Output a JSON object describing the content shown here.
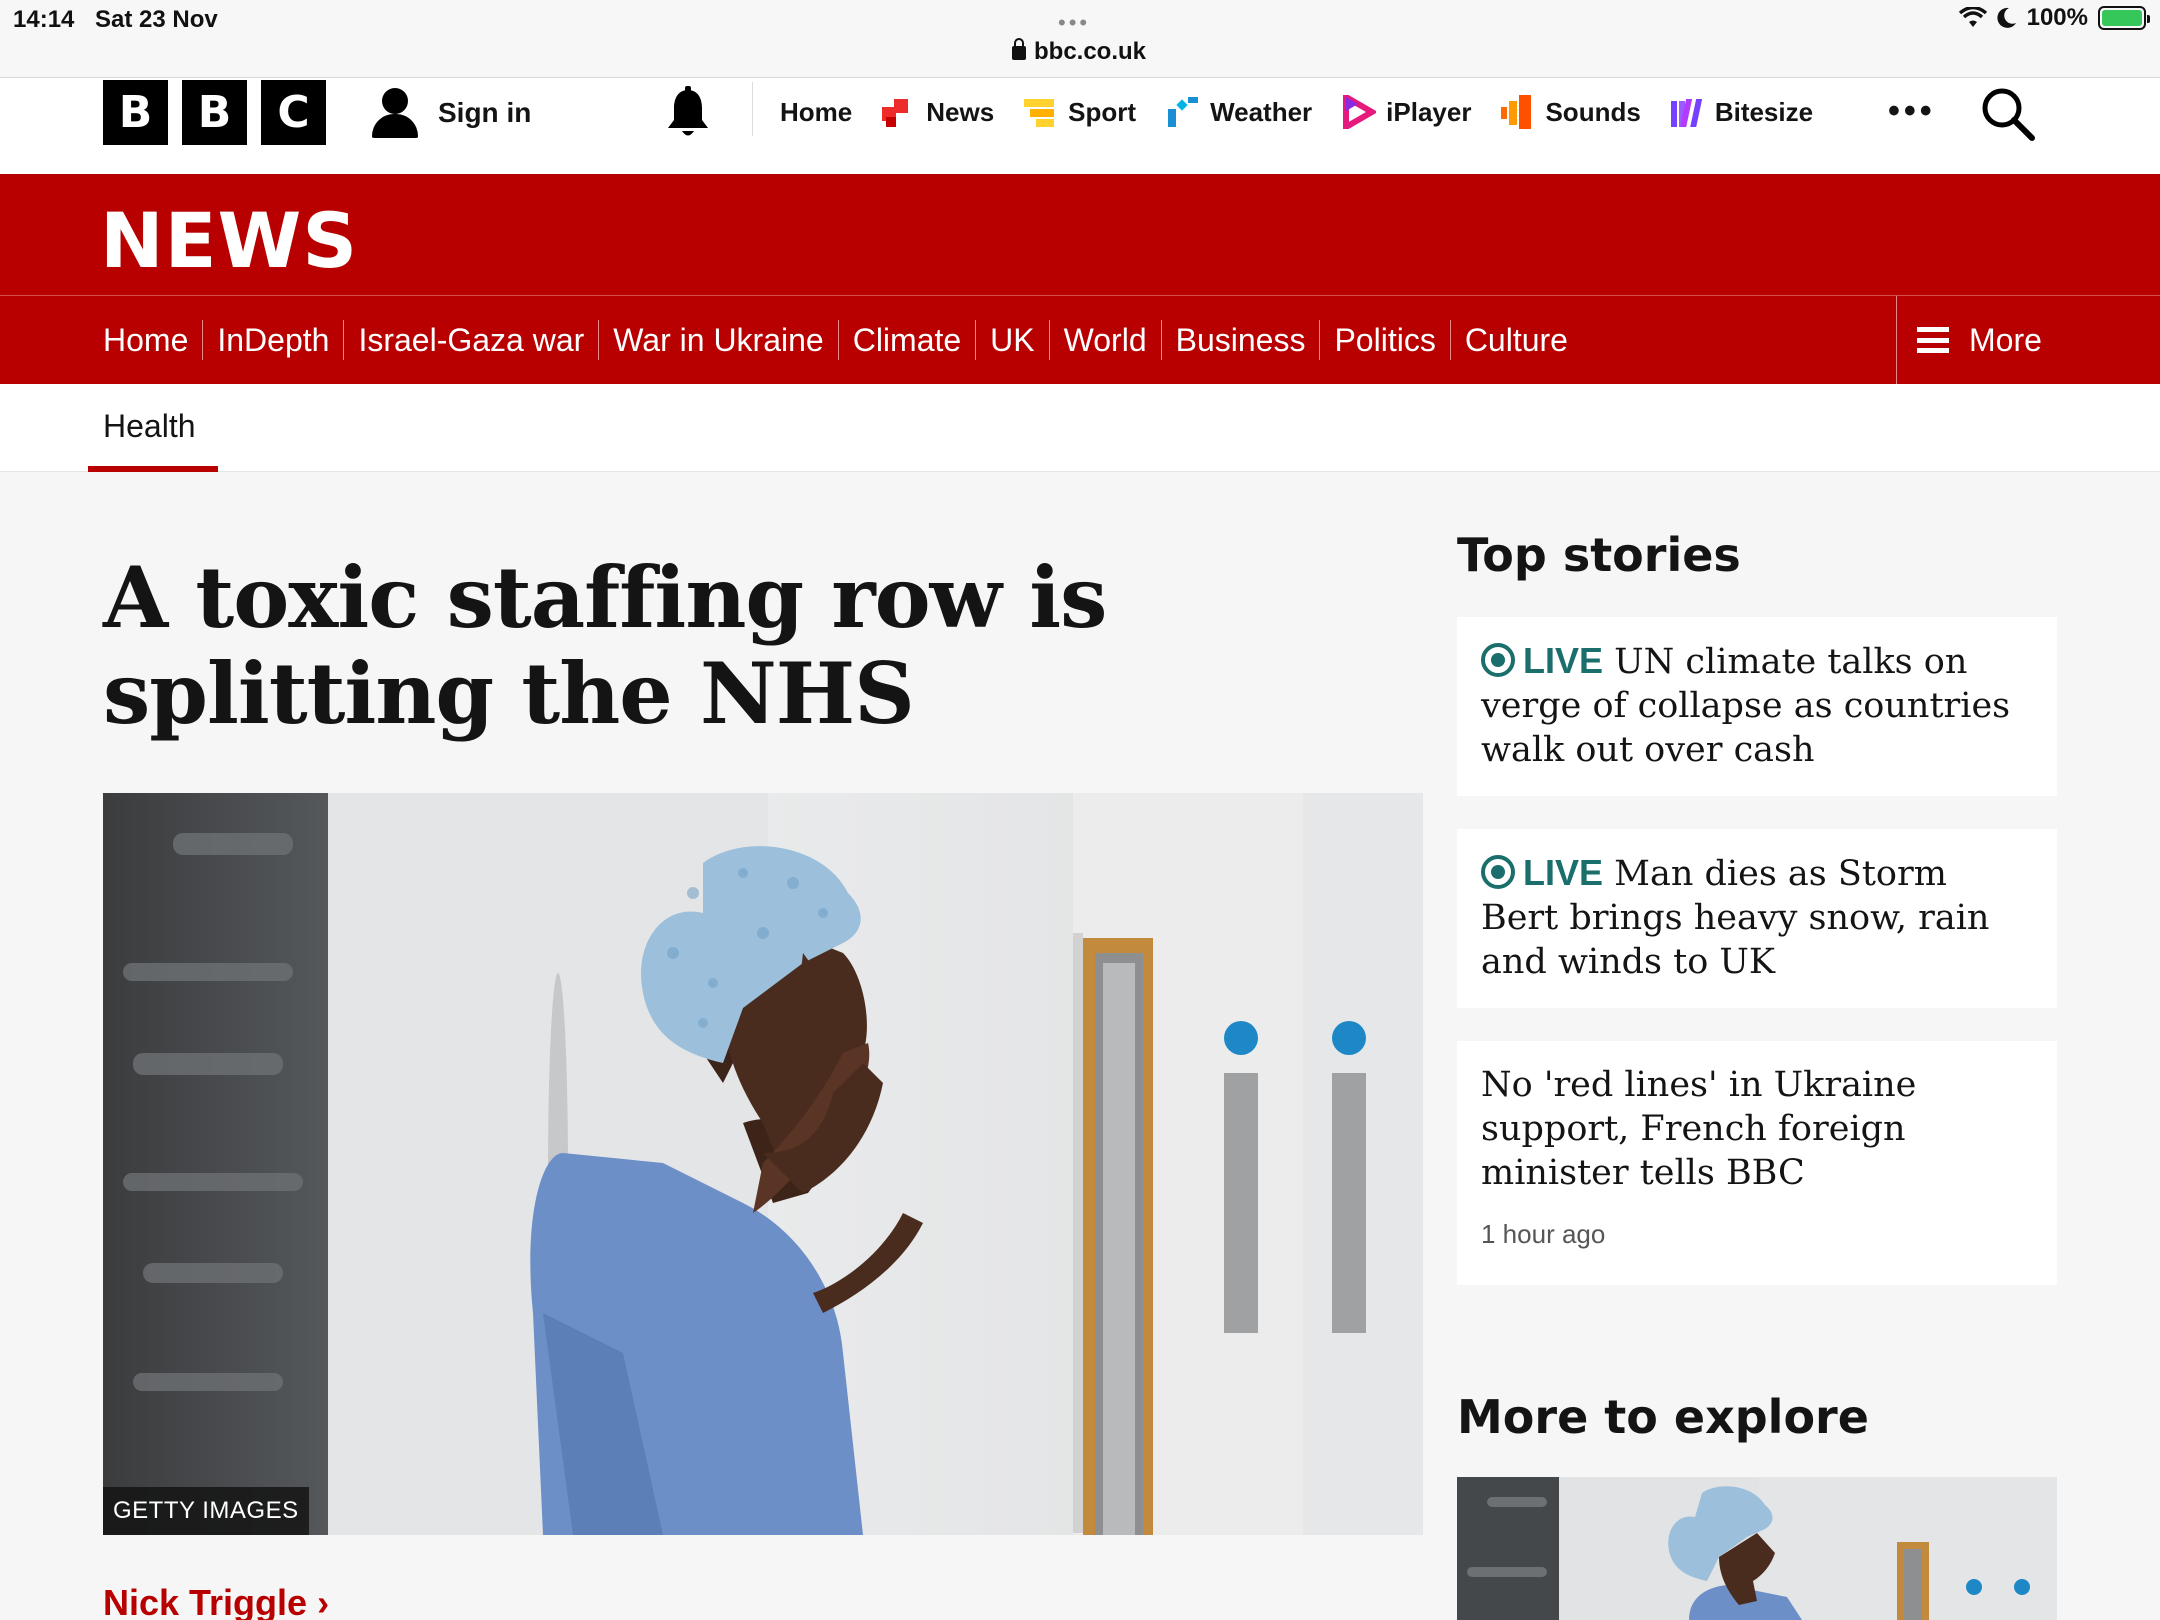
{
  "status_bar": {
    "time": "14:14",
    "date": "Sat 23 Nov",
    "url": "bbc.co.uk",
    "battery": "100%",
    "tab_dots": "•••"
  },
  "masthead": {
    "logo_letters": [
      "B",
      "B",
      "C"
    ],
    "signin_label": "Sign in",
    "nav": [
      {
        "label": "Home",
        "icon": "none"
      },
      {
        "label": "News",
        "icon": "news-icon",
        "color": "#ee2b2b"
      },
      {
        "label": "Sport",
        "icon": "sport-icon",
        "color": "#ffd230"
      },
      {
        "label": "Weather",
        "icon": "weather-icon",
        "color": "#1a8fd4"
      },
      {
        "label": "iPlayer",
        "icon": "iplayer-icon",
        "color": "#e6197d"
      },
      {
        "label": "Sounds",
        "icon": "sounds-icon",
        "color": "#ff6a00"
      },
      {
        "label": "Bitesize",
        "icon": "bitesize-icon",
        "color": "#7540ff"
      }
    ],
    "more_dots": "•••"
  },
  "news": {
    "title": "NEWS",
    "sections": [
      "Home",
      "InDepth",
      "Israel-Gaza war",
      "War in Ukraine",
      "Climate",
      "UK",
      "World",
      "Business",
      "Politics",
      "Culture"
    ],
    "more_label": "More",
    "brand_color": "#b80000"
  },
  "subnav": {
    "active": "Health"
  },
  "article": {
    "headline": "A toxic staffing row is splitting the NHS",
    "image_credit": "GETTY IMAGES",
    "byline": "Nick Triggle ›"
  },
  "sidebar": {
    "top_stories_title": "Top stories",
    "stories": [
      {
        "live": "LIVE",
        "text": "UN climate talks on verge of collapse as countries walk out over cash"
      },
      {
        "live": "LIVE",
        "text": "Man dies as Storm Bert brings heavy snow, rain and winds to UK"
      },
      {
        "live": "",
        "text": "No 'red lines' in Ukraine support, French foreign minister tells BBC",
        "time": "1 hour ago"
      }
    ],
    "live_color": "#1a6e6c",
    "more_title": "More to explore"
  }
}
